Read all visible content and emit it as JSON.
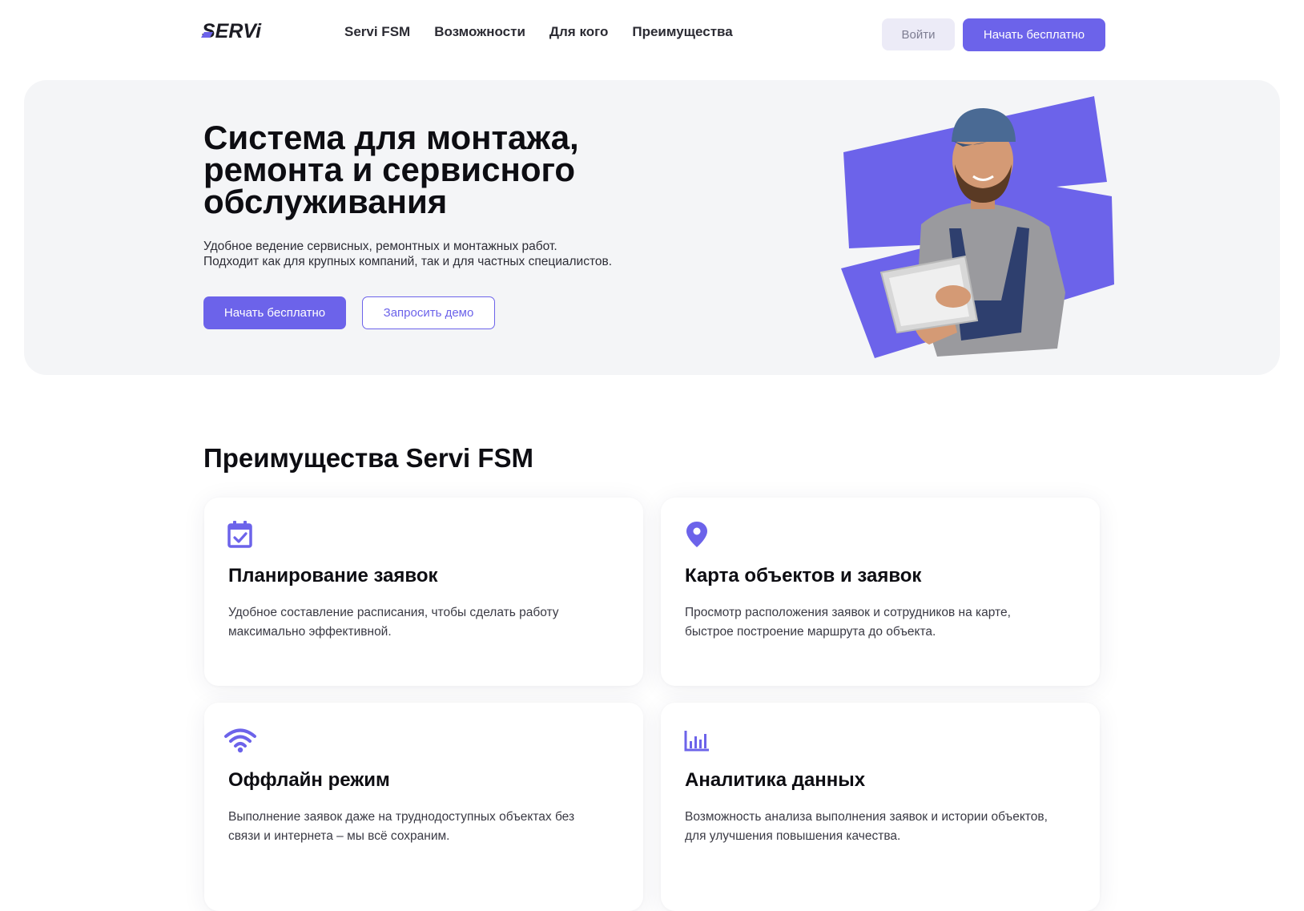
{
  "header": {
    "logo_text": "SERVi",
    "nav": [
      "Servi FSM",
      "Возможности",
      "Для кого",
      "Преимущества"
    ],
    "login_label": "Войти",
    "start_label": "Начать бесплатно"
  },
  "hero": {
    "title": "Система для монтажа, ремонта и сервисного обслуживания",
    "subtitle_lines": [
      "Удобное ведение сервисных, ремонтных и монтажных работ.",
      "Подходит как для крупных компаний, так и для частных специалистов."
    ],
    "start_label": "Начать бесплатно",
    "demo_label": "Запросить демо"
  },
  "features": {
    "title": "Преимущества Servi FSM",
    "cards": [
      {
        "icon": "calendar-check-icon",
        "title": "Планирование заявок",
        "text_lines": [
          "Удобное составление расписания, чтобы сделать работу",
          "максимально эффективной."
        ]
      },
      {
        "icon": "map-pin-icon",
        "title": "Карта объектов и заявок",
        "text_lines": [
          "Просмотр расположения заявок и сотрудников на карте,",
          "быстрое построение маршрута до объекта."
        ]
      },
      {
        "icon": "wifi-icon",
        "title": "Оффлайн режим",
        "text_lines": [
          "Выполнение заявок даже на труднодоступных объектах без",
          "связи и интернета – мы всё сохраним."
        ]
      },
      {
        "icon": "bar-chart-icon",
        "title": "Аналитика данных",
        "text_lines": [
          "Возможность анализа выполнения заявок и истории объектов,",
          "для улучшения повышения качества."
        ]
      }
    ]
  },
  "colors": {
    "accent": "#6c63ea",
    "hero_bg": "#f4f5f7",
    "login_bg": "#ecebf7"
  }
}
